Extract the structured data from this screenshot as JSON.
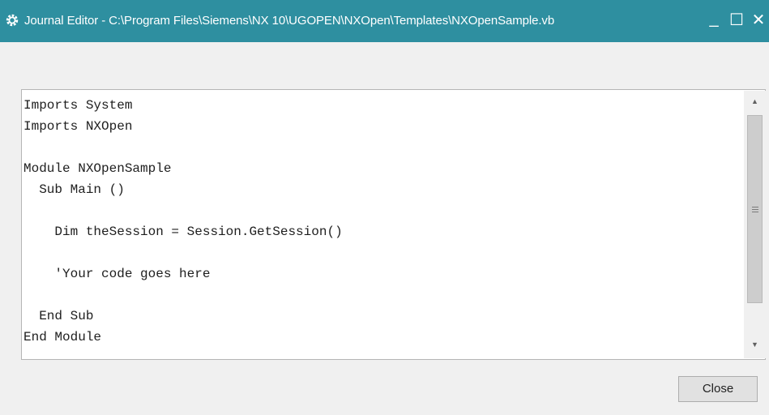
{
  "window": {
    "title": "Journal Editor - C:\\Program Files\\Siemens\\NX 10\\UGOPEN\\NXOpen\\Templates\\NXOpenSample.vb",
    "minimize_glyph": "_",
    "maximize_glyph": "☐",
    "close_glyph": "✕",
    "titlebar_color": "#2e8fa0"
  },
  "toolbar": {
    "buttons": [
      {
        "icon": "new-file-icon"
      },
      {
        "icon": "open-folder-icon"
      },
      {
        "icon": "save-icon"
      },
      {
        "icon": "save-as-icon"
      },
      {
        "icon": "cut-scissors-icon"
      },
      {
        "icon": "copy-icon"
      },
      {
        "icon": "paste-icon"
      },
      {
        "icon": "find-binoculars-icon"
      },
      {
        "icon": "replace-pointing-hand-icon"
      },
      {
        "icon": "run-play-icon"
      },
      {
        "icon": "help-icon"
      }
    ],
    "help_glyph": "?"
  },
  "editor": {
    "code": "Imports System\nImports NXOpen\n\nModule NXOpenSample\n  Sub Main ()\n\n    Dim theSession = Session.GetSession()\n\n    'Your code goes here\n\n  End Sub\nEnd Module"
  },
  "footer": {
    "close_label": "Close"
  }
}
